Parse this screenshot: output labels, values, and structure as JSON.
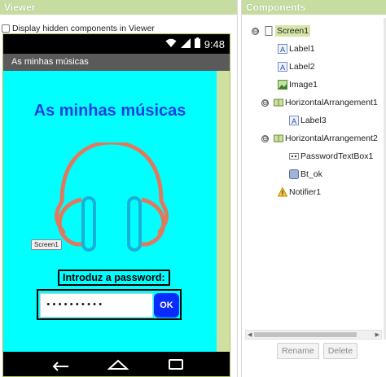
{
  "viewer": {
    "title": "Viewer",
    "hidden_components_label": "Display hidden components in Viewer",
    "status_time": "9:48",
    "app_bar_title": "As minhas músicas",
    "screen_title": "As minhas músicas",
    "screen_chip": "Screen1",
    "password_label": "Introduz a password:",
    "password_value": "••••••••••",
    "ok_label": "OK",
    "colors": {
      "screen_bg": "#00ffff",
      "title": "#1a3fe0",
      "ok_bg": "#0a2bff",
      "headphones_band": "#e07a5f",
      "headphones_cups": "#1ab0d8"
    }
  },
  "components": {
    "title": "Components",
    "tree": [
      {
        "label": "Screen1",
        "icon": "screen-icon",
        "toggle": "⊖"
      },
      {
        "label": "Label1",
        "icon": "label-icon"
      },
      {
        "label": "Label2",
        "icon": "label-icon"
      },
      {
        "label": "Image1",
        "icon": "image-icon"
      },
      {
        "label": "HorizontalArrangement1",
        "icon": "arrangement-icon",
        "toggle": "⊖"
      },
      {
        "label": "Label3",
        "icon": "label-icon"
      },
      {
        "label": "HorizontalArrangement2",
        "icon": "arrangement-icon",
        "toggle": "⊖"
      },
      {
        "label": "PasswordTextBox1",
        "icon": "password-icon"
      },
      {
        "label": "Bt_ok",
        "icon": "button-icon"
      },
      {
        "label": "Notifier1",
        "icon": "warning-icon"
      }
    ],
    "rename_label": "Rename",
    "delete_label": "Delete"
  }
}
